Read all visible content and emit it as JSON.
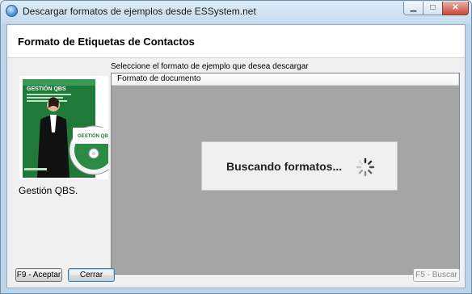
{
  "window": {
    "title": "Descargar formatos de ejemplos desde ESSystem.net"
  },
  "header": {
    "title": "Formato de Etiquetas de Contactos"
  },
  "product": {
    "box_brand": "GESTIÓN QBS",
    "disc_label": "GESTIÓN QBS",
    "caption": "Gestión QBS."
  },
  "main": {
    "prompt": "Seleccione el formato de ejemplo que desea descargar",
    "list": {
      "columns": [
        "Formato de documento"
      ]
    },
    "loading_text": "Buscando formatos..."
  },
  "buttons": {
    "accept": "F9 - Aceptar",
    "close": "Cerrar",
    "search": "F5 - Buscar"
  },
  "colors": {
    "accent": "#3c7fb1",
    "list_bg": "#a5a5a5",
    "brand_green": "#1f7a3a"
  }
}
